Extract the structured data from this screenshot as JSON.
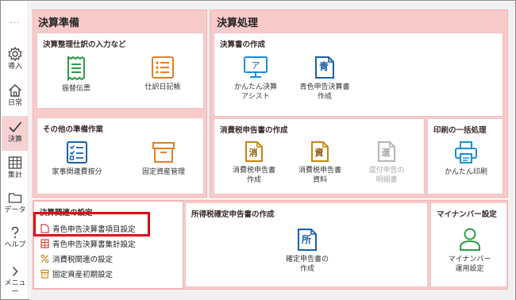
{
  "sidebar": {
    "more": "···",
    "items": [
      {
        "label": "導入",
        "icon": "gear-icon"
      },
      {
        "label": "日常",
        "icon": "home-icon"
      },
      {
        "label": "決算",
        "icon": "check-icon"
      },
      {
        "label": "集計",
        "icon": "table-icon"
      },
      {
        "label": "データ",
        "icon": "folder-icon"
      },
      {
        "label": "ヘルプ",
        "icon": "help-icon"
      },
      {
        "label": "メニュー",
        "icon": "chevron-right-icon"
      }
    ]
  },
  "prep": {
    "title": "決算準備",
    "entries": {
      "title": "決算整理仕訳の入力など",
      "tools": [
        {
          "label": "振替伝票",
          "icon": "receipt-icon"
        },
        {
          "label": "仕訳日記帳",
          "icon": "list-icon"
        }
      ]
    },
    "other": {
      "title": "その他の準備作業",
      "tools": [
        {
          "label": "家事関連費按分",
          "icon": "checklist-icon"
        },
        {
          "label": "固定資産管理",
          "icon": "box-icon"
        }
      ]
    }
  },
  "process": {
    "title": "決算処理",
    "statements": {
      "title": "決算書の作成",
      "tools": [
        {
          "label1": "かんたん決算",
          "label2": "アシスト",
          "glyph": "ア"
        },
        {
          "label1": "青色申告決算書",
          "label2": "作成",
          "glyph": "青"
        }
      ]
    },
    "consumption": {
      "title": "消費税申告書の作成",
      "tools": [
        {
          "label1": "消費税申告書",
          "label2": "作成",
          "glyph": "消"
        },
        {
          "label1": "消費税申告書",
          "label2": "資料",
          "glyph": "資"
        },
        {
          "label1": "還付申告の",
          "label2": "明細書",
          "glyph": "還"
        }
      ]
    },
    "print": {
      "title": "印刷の一括処理",
      "tool": {
        "label": "かんたん印刷",
        "icon": "printer-icon"
      }
    }
  },
  "settings": {
    "title": "決算関連の設定",
    "items": [
      "青色申告決算書項目設定",
      "青色申告決算書集計設定",
      "消費税関連の設定",
      "固定資産初期設定"
    ]
  },
  "income": {
    "title": "所得税確定申告書の作成",
    "tool": {
      "label1": "確定申告書の",
      "label2": "作成",
      "glyph": "所"
    }
  },
  "mynumber": {
    "title": "マイナンバー設定",
    "tool": {
      "label1": "マイナンバー",
      "label2": "運用設定",
      "icon": "person-icon"
    }
  },
  "colors": {
    "accent": "#1a6fb3",
    "highlight": "#e60012",
    "panel": "#f8caca",
    "active": "#f6d2d2",
    "icon_orange": "#e67e22",
    "icon_green": "#2e9b45"
  }
}
